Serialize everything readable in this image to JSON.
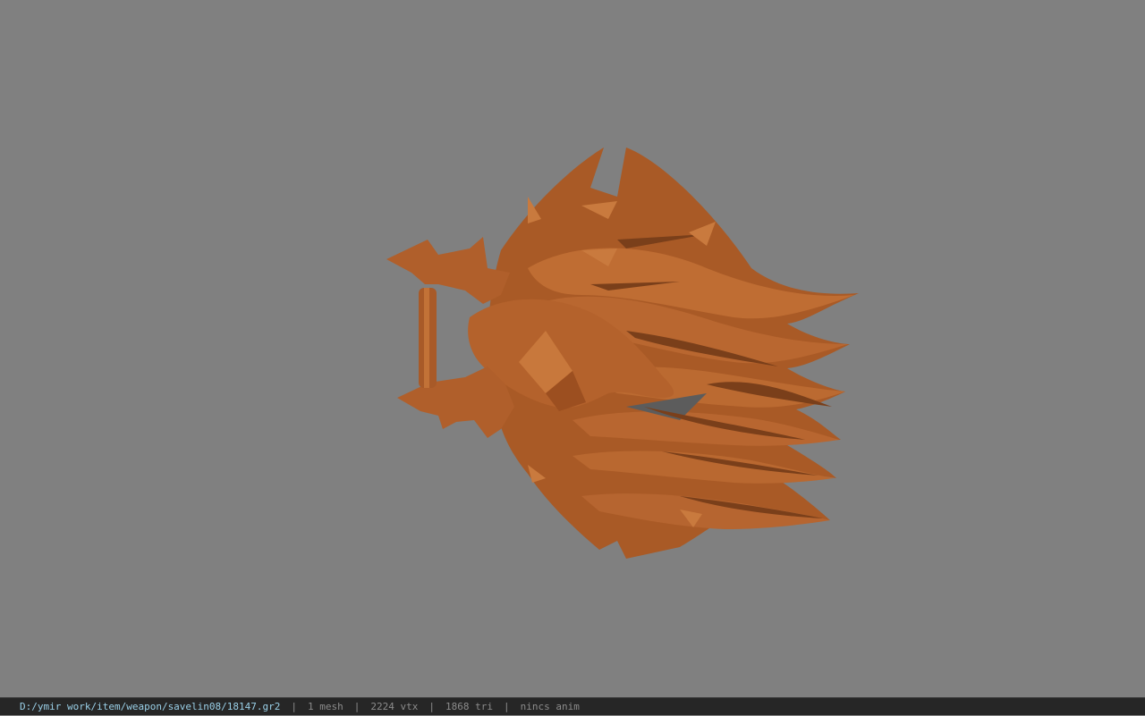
{
  "viewer": {
    "background_color": "#808080",
    "model_color": "#b5652f",
    "model": "weapon-mesh"
  },
  "status": {
    "path": "D:/ymir work/item/weapon/savelin08/18147.gr2",
    "separator": "|",
    "mesh": "1 mesh",
    "vtx": "2224 vtx",
    "tri": "1868 tri",
    "anim": "nincs anim"
  }
}
